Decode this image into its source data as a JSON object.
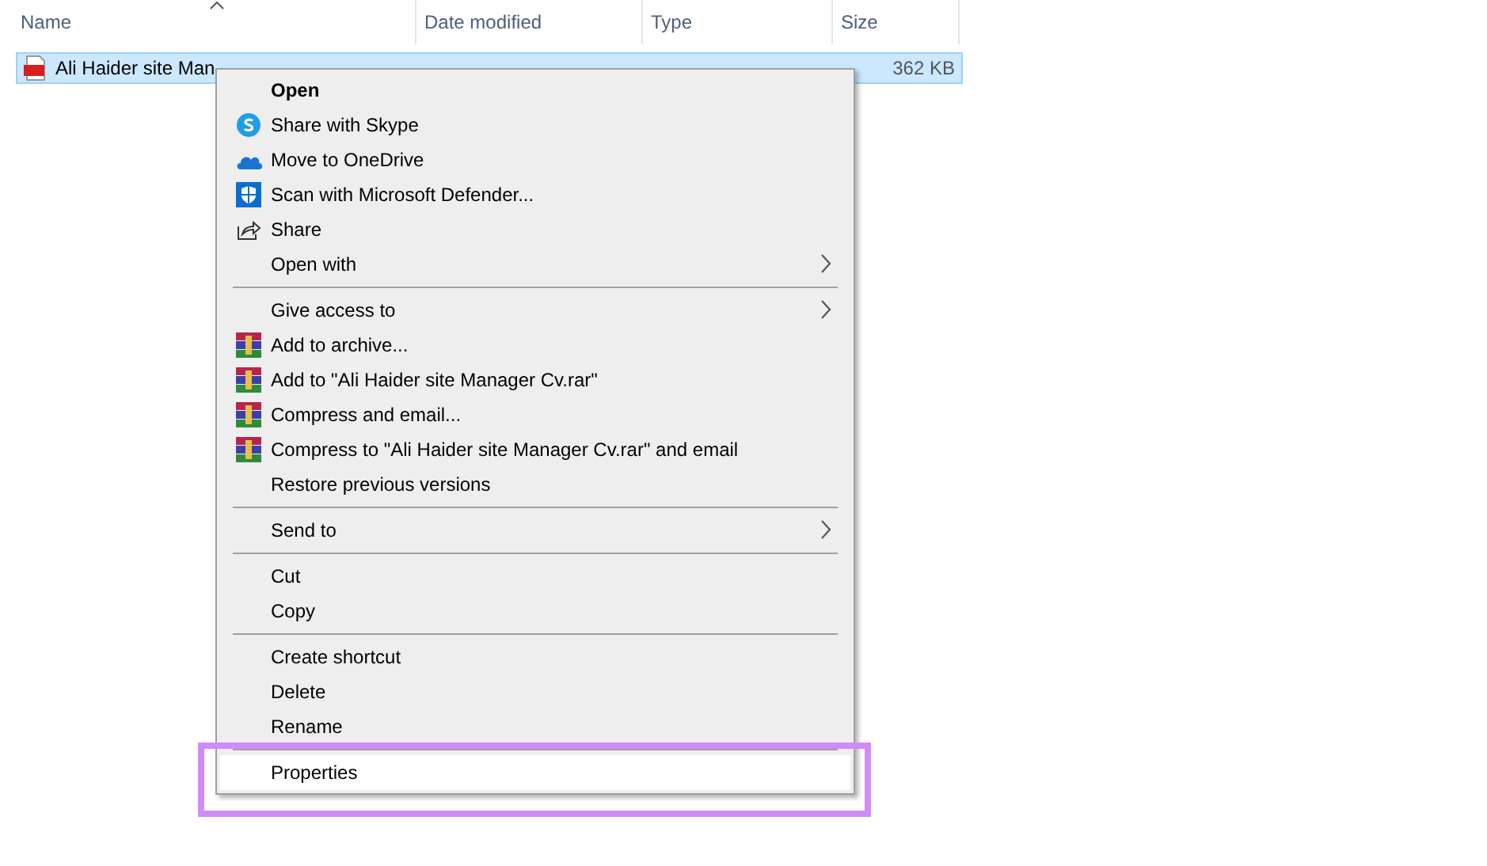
{
  "columns": [
    {
      "label": "Name",
      "sorted": true
    },
    {
      "label": "Date modified",
      "sorted": false
    },
    {
      "label": "Type",
      "sorted": false
    },
    {
      "label": "Size",
      "sorted": false
    }
  ],
  "file": {
    "name": "Ali Haider site Man",
    "size": "362 KB",
    "selected": true
  },
  "context_menu": {
    "groups": [
      [
        {
          "label": "Open",
          "kind": "plain",
          "default": true,
          "submenu": false,
          "selected": false
        },
        {
          "label": "Share with Skype",
          "kind": "skype",
          "default": false,
          "submenu": false,
          "selected": false
        },
        {
          "label": "Move to OneDrive",
          "kind": "cloud",
          "default": false,
          "submenu": false,
          "selected": false
        },
        {
          "label": "Scan with Microsoft Defender...",
          "kind": "shield",
          "default": false,
          "submenu": false,
          "selected": false
        },
        {
          "label": "Share",
          "kind": "share",
          "default": false,
          "submenu": false,
          "selected": false
        },
        {
          "label": "Open with",
          "kind": "plain",
          "default": false,
          "submenu": true,
          "selected": false
        }
      ],
      [
        {
          "label": "Give access to",
          "kind": "plain",
          "default": false,
          "submenu": true,
          "selected": false
        },
        {
          "label": "Add to archive...",
          "kind": "archive",
          "default": false,
          "submenu": false,
          "selected": false
        },
        {
          "label": "Add to \"Ali Haider site Manager Cv.rar\"",
          "kind": "archive",
          "default": false,
          "submenu": false,
          "selected": false
        },
        {
          "label": "Compress and email...",
          "kind": "archive",
          "default": false,
          "submenu": false,
          "selected": false
        },
        {
          "label": "Compress to \"Ali Haider site Manager Cv.rar\" and email",
          "kind": "archive",
          "default": false,
          "submenu": false,
          "selected": false
        },
        {
          "label": "Restore previous versions",
          "kind": "plain",
          "default": false,
          "submenu": false,
          "selected": false
        }
      ],
      [
        {
          "label": "Send to",
          "kind": "plain",
          "default": false,
          "submenu": true,
          "selected": false
        }
      ],
      [
        {
          "label": "Cut",
          "kind": "plain",
          "default": false,
          "submenu": false,
          "selected": false
        },
        {
          "label": "Copy",
          "kind": "plain",
          "default": false,
          "submenu": false,
          "selected": false
        }
      ],
      [
        {
          "label": "Create shortcut",
          "kind": "plain",
          "default": false,
          "submenu": false,
          "selected": false
        },
        {
          "label": "Delete",
          "kind": "plain",
          "default": false,
          "submenu": false,
          "selected": false
        },
        {
          "label": "Rename",
          "kind": "plain",
          "default": false,
          "submenu": false,
          "selected": false
        }
      ],
      [
        {
          "label": "Properties",
          "kind": "plain",
          "default": false,
          "submenu": false,
          "selected": true
        }
      ]
    ]
  },
  "highlight_frame": {
    "shown": true
  }
}
